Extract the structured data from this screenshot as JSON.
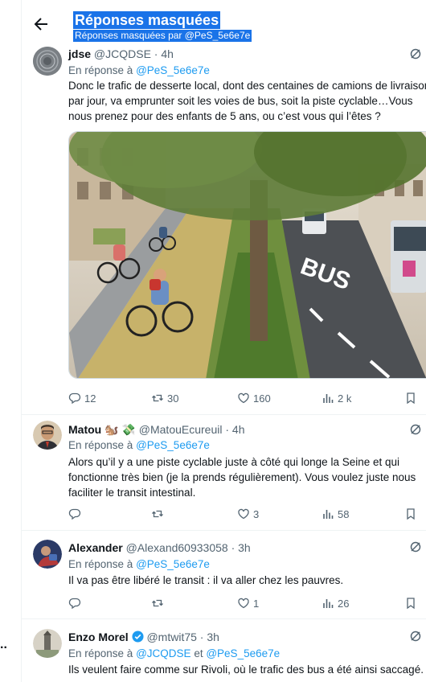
{
  "header": {
    "title": "Réponses masquées",
    "subtitle": "Réponses masquées par @PeS_5e6e7e"
  },
  "gutter": {
    "dots": ".."
  },
  "tweets": [
    {
      "name": "jdse",
      "handle": "@JCQDSE",
      "time": "4h",
      "reply_prefix": "En réponse à",
      "reply_to": "@PeS_5e6e7e",
      "text_lines": [
        "Donc le trafic de desserte local, dont des centaines de camions de livraison",
        "par jour, va emprunter soit les voies de bus, soit la piste cyclable…Vous",
        "nous prenez pour des enfants de 5 ans, ou c’est vous qui l’êtes ?"
      ],
      "media_text": "BUS",
      "stats": {
        "replies": "12",
        "retweets": "30",
        "likes": "160",
        "views": "2 k"
      }
    },
    {
      "name": "Matou",
      "emojis": "🐿️ 💸",
      "handle": "@MatouEcureuil",
      "time": "4h",
      "reply_prefix": "En réponse à",
      "reply_to": "@PeS_5e6e7e",
      "text_lines": [
        "Alors qu’il y a une piste cyclable juste à côté qui longe la Seine et qui",
        "fonctionne très bien (je la prends régulièrement). Vous voulez juste nous",
        "faciliter le transit intestinal."
      ],
      "stats": {
        "replies": "",
        "retweets": "",
        "likes": "3",
        "views": "58"
      }
    },
    {
      "name": "Alexander",
      "handle": "@Alexand60933058",
      "time": "3h",
      "reply_prefix": "En réponse à",
      "reply_to": "@PeS_5e6e7e",
      "text_lines": [
        "Il va pas être libéré le transit : il va aller chez les pauvres."
      ],
      "stats": {
        "replies": "",
        "retweets": "",
        "likes": "1",
        "views": "26"
      }
    },
    {
      "name": "Enzo Morel",
      "handle": "@mtwit75",
      "time": "3h",
      "reply_prefix": "En réponse à",
      "reply_to": "@JCQDSE",
      "reply_joiner": "et",
      "reply_to_2": "@PeS_5e6e7e",
      "text_lines": [
        "Ils veulent faire comme sur Rivoli, où le trafic des bus a été ainsi saccagé."
      ]
    }
  ],
  "colors": {
    "accent": "#1d9bf0",
    "muted": "#536471",
    "verified": "#1d9bf0",
    "selection": "#1a73e8"
  },
  "icons": {
    "back": "arrow-left-icon",
    "more": "slashed-circle-icon",
    "reply": "reply-icon",
    "retweet": "retweet-icon",
    "like": "heart-icon",
    "views": "views-icon",
    "bookmark": "bookmark-icon"
  }
}
